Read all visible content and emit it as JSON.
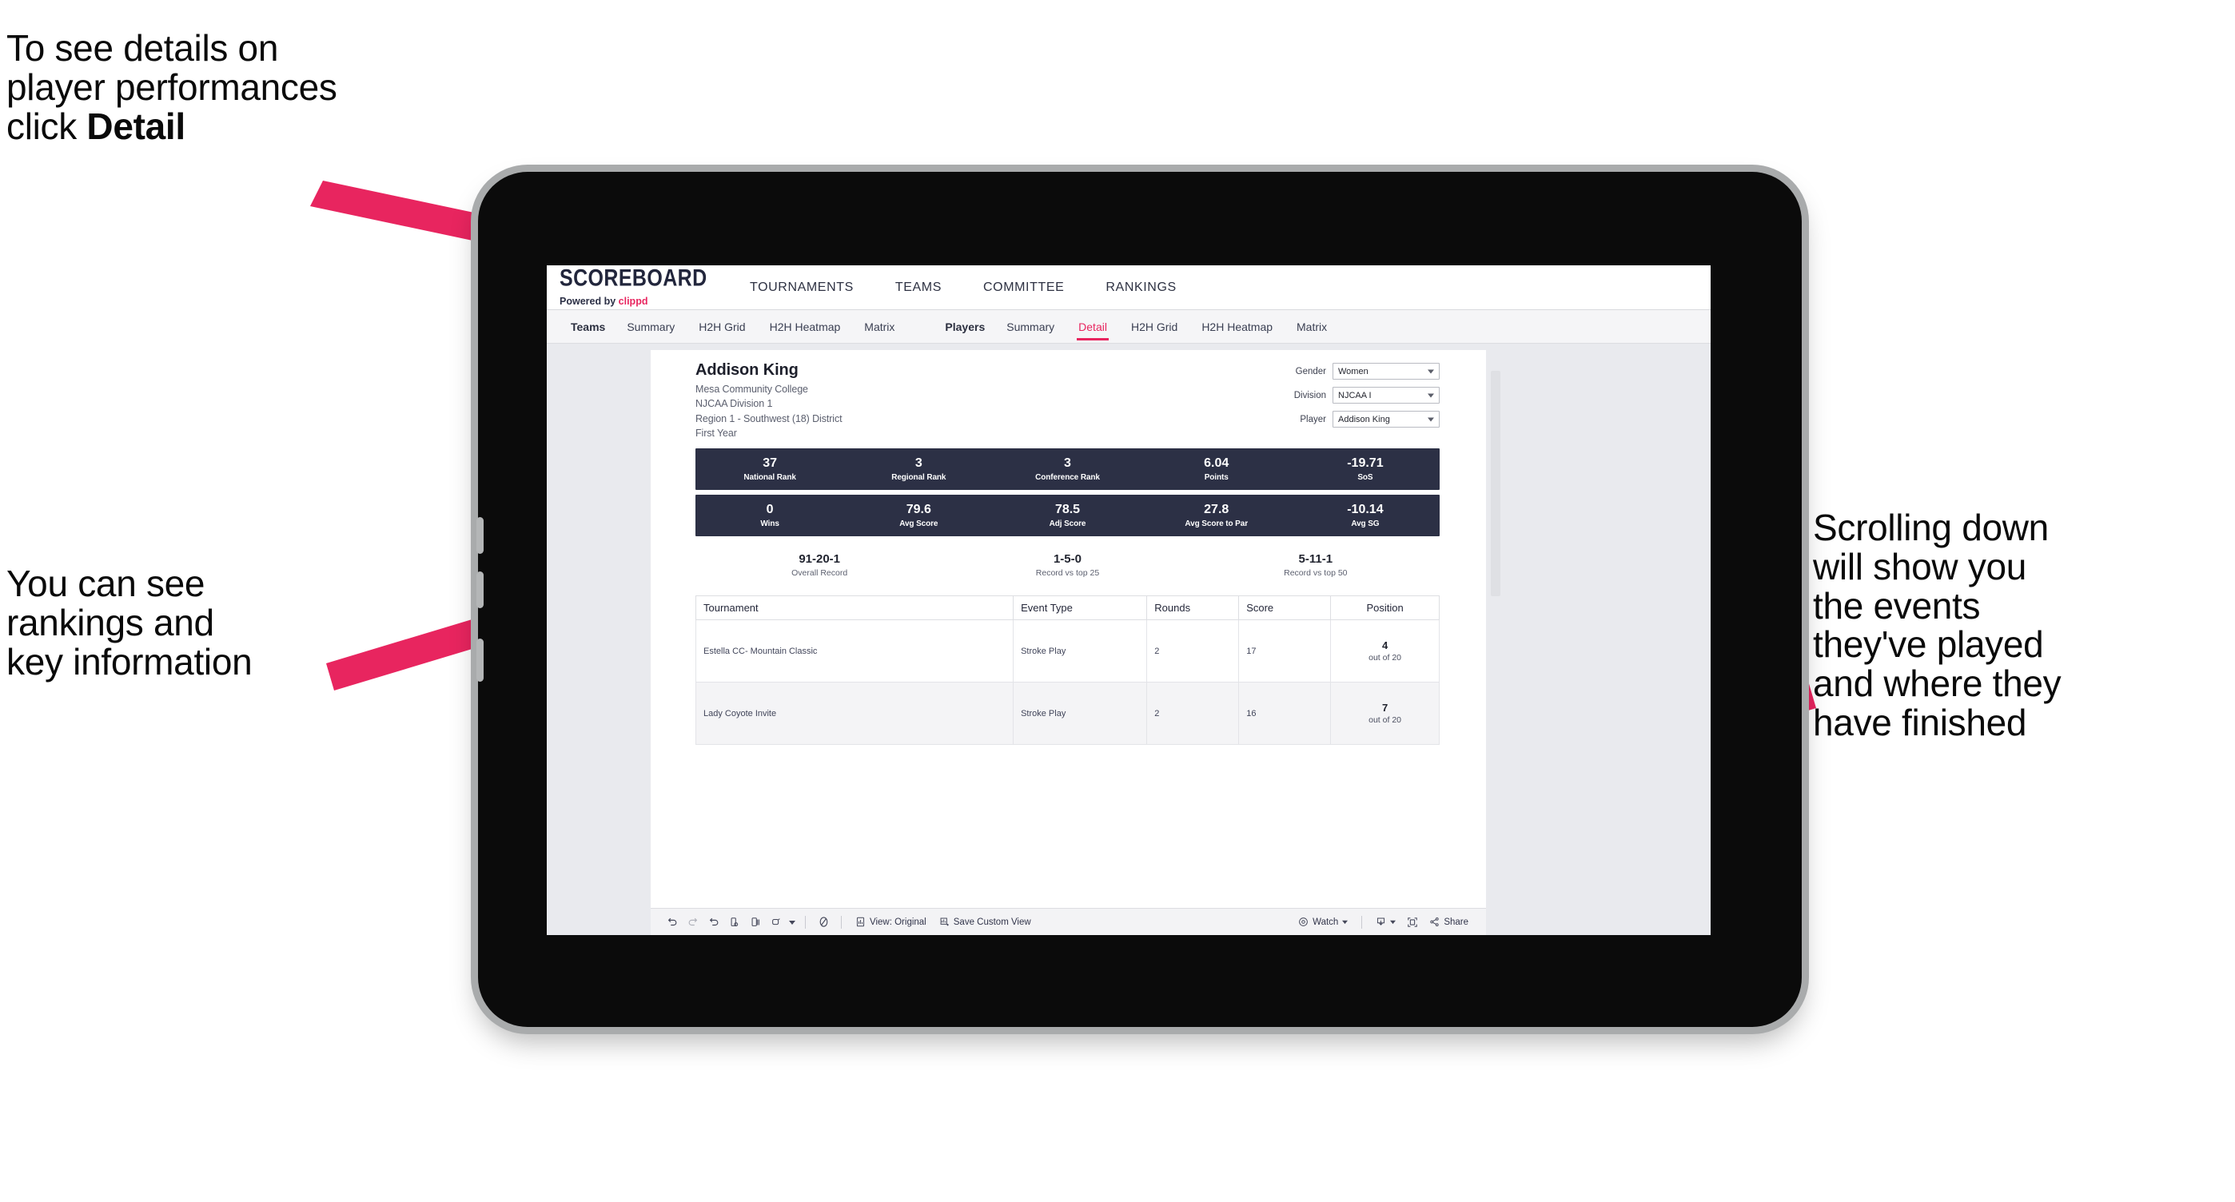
{
  "annotations": {
    "top_left": "To see details on\nplayer performances\nclick ",
    "top_left_bold": "Detail",
    "mid_left": "You can see\nrankings and\nkey information",
    "right": "Scrolling down\nwill show you\nthe events\nthey've played\nand where they\nhave finished",
    "arrow_color": "#e8255f"
  },
  "app": {
    "logo": {
      "word": "SCOREBOARD",
      "powered_by": "Powered by",
      "brand": "clippd"
    },
    "top_nav": [
      "TOURNAMENTS",
      "TEAMS",
      "COMMITTEE",
      "RANKINGS"
    ],
    "subnav": {
      "teams_label": "Teams",
      "teams_tabs": [
        "Summary",
        "H2H Grid",
        "H2H Heatmap",
        "Matrix"
      ],
      "players_label": "Players",
      "players_tabs": [
        "Summary",
        "Detail",
        "H2H Grid",
        "H2H Heatmap",
        "Matrix"
      ],
      "active_tab": "Detail",
      "accent": "#e8255f"
    }
  },
  "player": {
    "name": "Addison King",
    "school": "Mesa Community College",
    "division": "NJCAA Division 1",
    "region": "Region 1 - Southwest (18) District",
    "year": "First Year"
  },
  "filters": [
    {
      "label": "Gender",
      "value": "Women"
    },
    {
      "label": "Division",
      "value": "NJCAA I"
    },
    {
      "label": "Player",
      "value": "Addison King"
    }
  ],
  "stats_row1": [
    {
      "value": "37",
      "label": "National Rank"
    },
    {
      "value": "3",
      "label": "Regional Rank"
    },
    {
      "value": "3",
      "label": "Conference Rank"
    },
    {
      "value": "6.04",
      "label": "Points"
    },
    {
      "value": "-19.71",
      "label": "SoS"
    }
  ],
  "stats_row2": [
    {
      "value": "0",
      "label": "Wins"
    },
    {
      "value": "79.6",
      "label": "Avg Score"
    },
    {
      "value": "78.5",
      "label": "Adj Score"
    },
    {
      "value": "27.8",
      "label": "Avg Score to Par"
    },
    {
      "value": "-10.14",
      "label": "Avg SG"
    }
  ],
  "records": [
    {
      "value": "91-20-1",
      "label": "Overall Record"
    },
    {
      "value": "1-5-0",
      "label": "Record vs top 25"
    },
    {
      "value": "5-11-1",
      "label": "Record vs top 50"
    }
  ],
  "table": {
    "headers": [
      "Tournament",
      "Event Type",
      "Rounds",
      "Score",
      "Position"
    ],
    "rows": [
      {
        "tournament": "Estella CC- Mountain Classic",
        "event_type": "Stroke Play",
        "rounds": "2",
        "score": "17",
        "position": "4",
        "position_out_of": "out of 20"
      },
      {
        "tournament": "Lady Coyote Invite",
        "event_type": "Stroke Play",
        "rounds": "2",
        "score": "16",
        "position": "7",
        "position_out_of": "out of 20"
      }
    ]
  },
  "toolbar": {
    "view_label": "View: Original",
    "save_label": "Save Custom View",
    "watch_label": "Watch",
    "share_label": "Share"
  }
}
